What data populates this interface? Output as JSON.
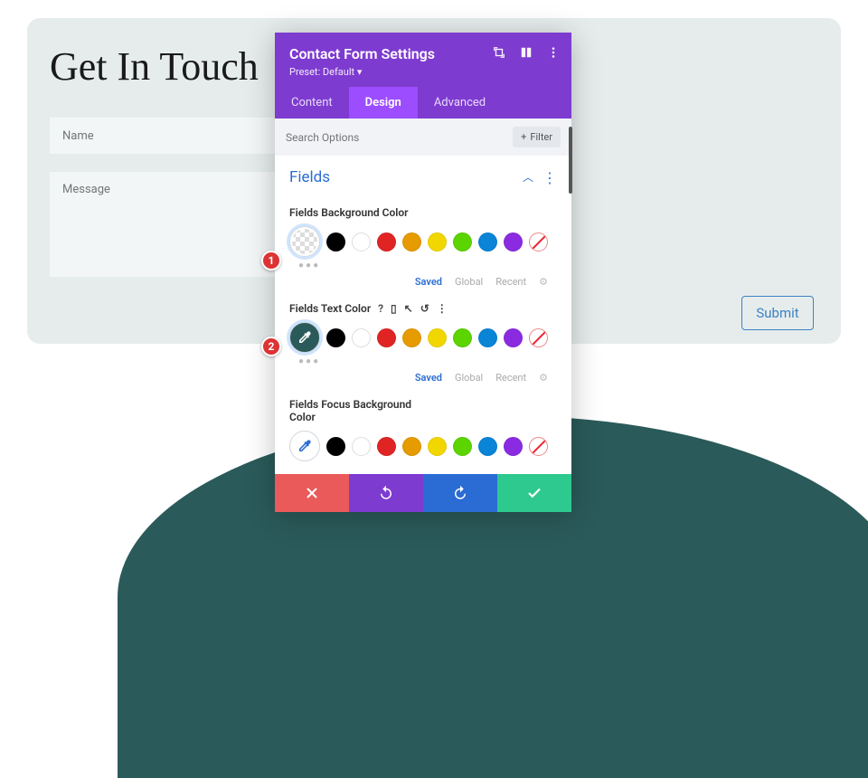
{
  "page": {
    "title": "Get In Touch"
  },
  "form": {
    "name_placeholder": "Name",
    "message_placeholder": "Message",
    "submit_label": "Submit"
  },
  "panel": {
    "title": "Contact Form Settings",
    "preset_label": "Preset: Default ▾",
    "tabs": {
      "content": "Content",
      "design": "Design",
      "advanced": "Advanced"
    },
    "search_placeholder": "Search Options",
    "filter_label": "Filter",
    "section_title": "Fields",
    "options": {
      "bg": {
        "label": "Fields Background Color"
      },
      "text": {
        "label": "Fields Text Color"
      },
      "focus": {
        "label": "Fields Focus Background Color"
      }
    },
    "states": {
      "saved": "Saved",
      "global": "Global",
      "recent": "Recent"
    },
    "swatches": [
      "#000000",
      "#ffffff",
      "#e02424",
      "#e69b00",
      "#f2d600",
      "#5bd400",
      "#0a84d6",
      "#8a2be2"
    ],
    "eyedropper_teal": "#2b5a5a",
    "eyedropper_blue": "#2b6cd4",
    "footer_colors": {
      "cancel": "#eb5a5a",
      "undo": "#7e3bd0",
      "redo": "#2b6cd4",
      "ok": "#2dc98f"
    }
  },
  "badges": {
    "one": "1",
    "two": "2"
  }
}
